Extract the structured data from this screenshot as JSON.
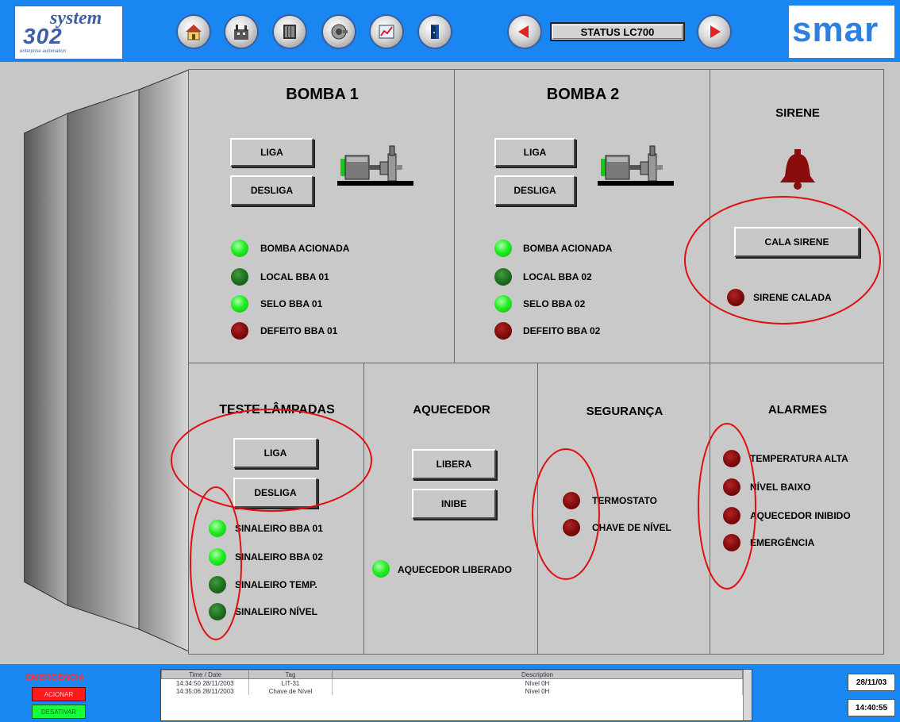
{
  "header": {
    "logo_left": {
      "line1": "system",
      "line2": "302",
      "tagline": "enterprise automation"
    },
    "logo_right": "smar",
    "status_label": "STATUS LC700",
    "nav_icons": [
      "home-icon",
      "factory-icon",
      "rack-icon",
      "motor-icon",
      "chart-icon",
      "door-icon",
      "arrow-left-icon",
      "arrow-right-icon"
    ]
  },
  "bomba1": {
    "title": "BOMBA 1",
    "btn_liga": "LIGA",
    "btn_desliga": "DESLIGA",
    "indicators": [
      {
        "label": "BOMBA    ACIONADA",
        "state": "on"
      },
      {
        "label": "LOCAL      BBA 01",
        "state": "off"
      },
      {
        "label": "SELO BBA 01",
        "state": "on"
      },
      {
        "label": "DEFEITO BBA 01",
        "state": "red"
      }
    ]
  },
  "bomba2": {
    "title": "BOMBA 2",
    "btn_liga": "LIGA",
    "btn_desliga": "DESLIGA",
    "indicators": [
      {
        "label": "BOMBA    ACIONADA",
        "state": "on"
      },
      {
        "label": "LOCAL      BBA 02",
        "state": "off"
      },
      {
        "label": "SELO BBA 02",
        "state": "on"
      },
      {
        "label": "DEFEITO BBA 02",
        "state": "red"
      }
    ]
  },
  "sirene": {
    "title": "SIRENE",
    "btn_cala": "CALA SIRENE",
    "indicator": {
      "label": "SIRENE   CALADA",
      "state": "red"
    }
  },
  "teste_lampadas": {
    "title": "TESTE LÂMPADAS",
    "btn_liga": "LIGA",
    "btn_desliga": "DESLIGA",
    "indicators": [
      {
        "label": "SINALEIRO BBA 01",
        "state": "on"
      },
      {
        "label": "SINALEIRO BBA 02",
        "state": "on"
      },
      {
        "label": "SINALEIRO TEMP.",
        "state": "off"
      },
      {
        "label": "SINALEIRO NÍVEL",
        "state": "off"
      }
    ]
  },
  "aquecedor": {
    "title": "AQUECEDOR",
    "btn_libera": "LIBERA",
    "btn_inibe": "INIBE",
    "indicator": {
      "label": "AQUECEDOR  LIBERADO",
      "state": "on"
    }
  },
  "seguranca": {
    "title": "SEGURANÇA",
    "indicators": [
      {
        "label": "TERMOSTATO",
        "state": "red"
      },
      {
        "label": "CHAVE DE NÍVEL",
        "state": "red"
      }
    ]
  },
  "alarmes": {
    "title": "ALARMES",
    "indicators": [
      {
        "label": "TEMPERATURA ALTA",
        "state": "red"
      },
      {
        "label": "NÍVEL BAIXO",
        "state": "red"
      },
      {
        "label": "AQUECEDOR INIBIDO",
        "state": "red"
      },
      {
        "label": "EMERGÊNCIA",
        "state": "red"
      }
    ]
  },
  "footer": {
    "emergency": {
      "title": "EMERGÊNCIA",
      "btn_acionar": "ACIONAR",
      "btn_desativar": "DESATIVAR"
    },
    "alarm_table": {
      "headers": [
        "Time / Date",
        "Tag",
        "Description"
      ],
      "rows": [
        [
          "14:34:50   28/11/2003",
          "LIT-31",
          "Nível 0H"
        ],
        [
          "14:35:06   28/11/2003",
          "Chave de Nível",
          "Nível 0H"
        ]
      ]
    },
    "date": "28/11/03",
    "time": "14:40:55"
  },
  "colors": {
    "header_blue": "#1a86f2",
    "led_on": "#22ee22",
    "led_off": "#1d6b1d",
    "led_red": "#7d0a0a",
    "annotation_red": "#e01010"
  }
}
